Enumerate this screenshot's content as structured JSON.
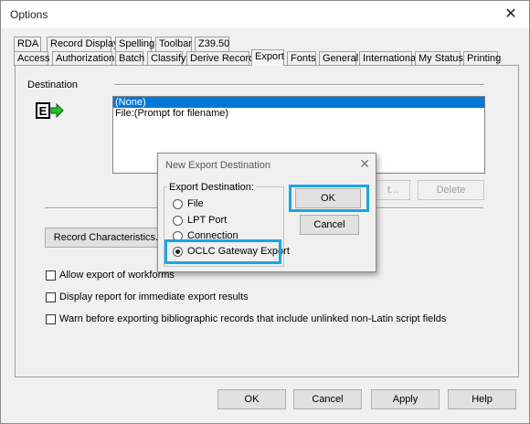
{
  "window": {
    "title": "Options",
    "close_glyph": "✕"
  },
  "tabs_row1": [
    "RDA",
    "Record Display",
    "Spelling",
    "Toolbar",
    "Z39.50"
  ],
  "tabs_row2": [
    "Access",
    "Authorizations",
    "Batch",
    "Classify",
    "Derive Record",
    "Export",
    "Fonts",
    "General",
    "International",
    "My Status",
    "Printing"
  ],
  "active_tab": "Export",
  "destination": {
    "label": "Destination",
    "icon": "export-e-arrow-icon",
    "items": [
      "(None)",
      "File:(Prompt for filename)"
    ],
    "selected_index": 0,
    "partial_button": "t...",
    "delete_button": "Delete"
  },
  "record_characteristics_button": "Record Characteristics...",
  "options": [
    {
      "label": "Allow export of workforms",
      "checked": false
    },
    {
      "label": "Display report for immediate export results",
      "checked": false
    },
    {
      "label": "Warn before exporting bibliographic records that include unlinked non-Latin script fields",
      "checked": false
    }
  ],
  "footer": {
    "ok": "OK",
    "cancel": "Cancel",
    "apply": "Apply",
    "help": "Help"
  },
  "dialog": {
    "title": "New Export Destination",
    "close_glyph": "✕",
    "group_label": "Export Destination:",
    "radios": [
      "File",
      "LPT Port",
      "Connection",
      "OCLC Gateway Export"
    ],
    "selected_index": 3,
    "ok": "OK",
    "cancel": "Cancel"
  },
  "highlight_color": "#1aa6e0",
  "selection_color": "#0078d7"
}
